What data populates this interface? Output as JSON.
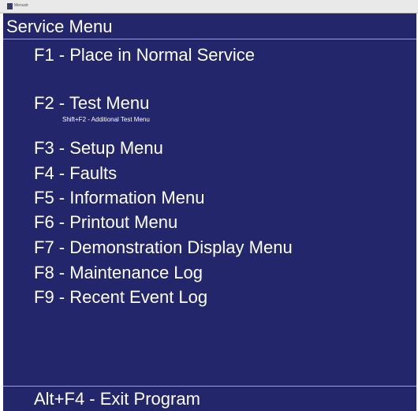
{
  "window": {
    "title": "Menustr"
  },
  "header": {
    "title": "Service Menu"
  },
  "menu": {
    "items": [
      {
        "label": "F1 - Place in Normal Service"
      },
      {
        "label": "F2 - Test Menu",
        "note": "Shift+F2 - Additional Test Menu"
      },
      {
        "label": "F3 - Setup Menu"
      },
      {
        "label": "F4 - Faults"
      },
      {
        "label": "F5 - Information Menu"
      },
      {
        "label": "F6 - Printout Menu"
      },
      {
        "label": "F7 - Demonstration Display Menu"
      },
      {
        "label": "F8 - Maintenance Log"
      },
      {
        "label": "F9 - Recent Event Log"
      }
    ]
  },
  "footer": {
    "exit_label": "Alt+F4 - Exit Program"
  },
  "colors": {
    "background": "#23266b",
    "text": "#ffffff",
    "rule": "#9ea1cc"
  }
}
